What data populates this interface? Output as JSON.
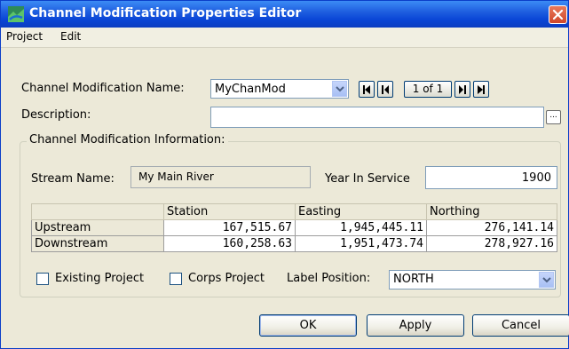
{
  "window": {
    "title": "Channel Modification Properties Editor",
    "icon": "app-logo-icon",
    "close_icon": "close-icon",
    "title_gradient_color": "#0a46d6",
    "close_color": "#d0462a"
  },
  "menu": [
    "Project",
    "Edit"
  ],
  "name": {
    "label": "Channel Modification Name:",
    "value": "MyChanMod"
  },
  "pager": {
    "text": "1 of 1",
    "icons": [
      "first-record-icon",
      "previous-record-icon",
      "next-record-icon",
      "last-record-icon"
    ]
  },
  "description": {
    "label": "Description:",
    "value": "",
    "browse_label": "..."
  },
  "group": {
    "title": "Channel Modification Information:"
  },
  "stream": {
    "label": "Stream Name:",
    "value": "My Main River"
  },
  "year": {
    "label": "Year In Service",
    "value": "1900"
  },
  "table": {
    "columns": [
      "",
      "Station",
      "Easting",
      "Northing"
    ],
    "rows": [
      {
        "label": "Upstream",
        "station": "167,515.67",
        "easting": "1,945,445.11",
        "northing": "276,141.14"
      },
      {
        "label": "Downstream",
        "station": "160,258.63",
        "easting": "1,951,473.74",
        "northing": "278,927.16"
      }
    ]
  },
  "options": {
    "existing_label": "Existing Project",
    "existing_checked": false,
    "corps_label": "Corps Project",
    "corps_checked": false,
    "label_position_label": "Label Position:",
    "label_position_value": "NORTH"
  },
  "buttons": {
    "ok": "OK",
    "apply": "Apply",
    "cancel": "Cancel"
  }
}
